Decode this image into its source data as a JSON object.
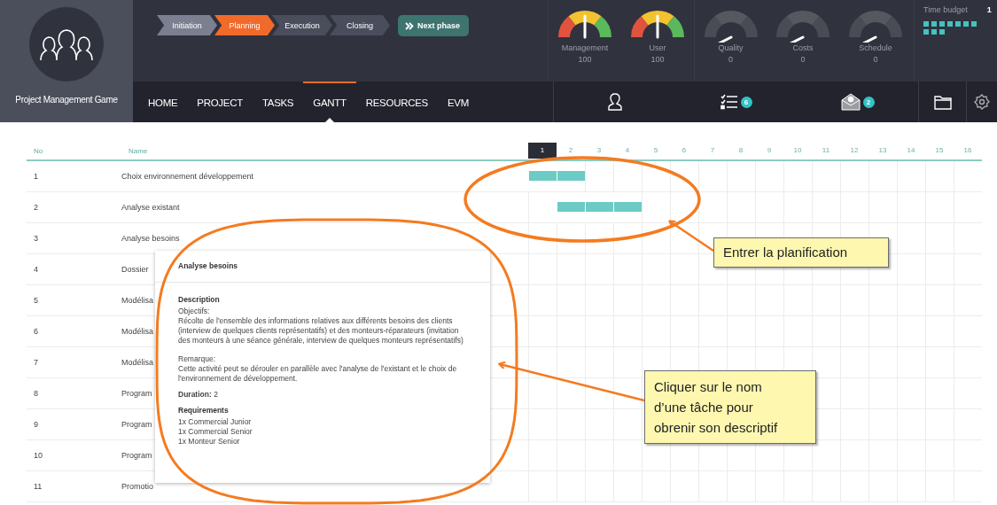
{
  "app": {
    "title": "Project Management Game"
  },
  "phases": [
    {
      "label": "Initiation",
      "completed": true,
      "selected": false
    },
    {
      "label": "Planning",
      "completed": false,
      "selected": true
    },
    {
      "label": "Execution",
      "completed": false,
      "selected": false
    },
    {
      "label": "Closing",
      "completed": false,
      "selected": false
    }
  ],
  "next_phase_button": {
    "label": "Next phase"
  },
  "gauges": [
    {
      "label": "Management",
      "value": "100",
      "kind": "colored"
    },
    {
      "label": "User",
      "value": "100",
      "kind": "colored"
    },
    {
      "label": "Quality",
      "value": "0",
      "kind": "plain"
    },
    {
      "label": "Costs",
      "value": "0",
      "kind": "plain"
    },
    {
      "label": "Schedule",
      "value": "0",
      "kind": "plain"
    }
  ],
  "time_budget": {
    "label": "Time budget",
    "value": "1",
    "blocks": [
      true,
      true,
      true,
      true,
      true,
      true,
      true,
      true,
      true,
      true
    ]
  },
  "nav_tabs": [
    {
      "label": "HOME",
      "selected": false
    },
    {
      "label": "PROJECT",
      "selected": false
    },
    {
      "label": "TASKS",
      "selected": false
    },
    {
      "label": "GANTT",
      "selected": true
    },
    {
      "label": "RESOURCES",
      "selected": false
    },
    {
      "label": "EVM",
      "selected": false
    }
  ],
  "toolbar": [
    {
      "kind": "person"
    },
    {
      "kind": "checklist",
      "badge": "6"
    },
    {
      "kind": "mail",
      "badge": "2"
    },
    {
      "kind": "folder"
    },
    {
      "kind": "settings"
    }
  ],
  "gantt": {
    "columns": {
      "no": "No",
      "name": "Name"
    },
    "weeks": [
      {
        "label": "1",
        "current": true
      },
      {
        "label": "2",
        "current": false
      },
      {
        "label": "3",
        "current": false
      },
      {
        "label": "4",
        "current": false
      },
      {
        "label": "5",
        "current": false
      },
      {
        "label": "6",
        "current": false
      },
      {
        "label": "7",
        "current": false
      },
      {
        "label": "8",
        "current": false
      },
      {
        "label": "9",
        "current": false
      },
      {
        "label": "10",
        "current": false
      },
      {
        "label": "11",
        "current": false
      },
      {
        "label": "12",
        "current": false
      },
      {
        "label": "13",
        "current": false
      },
      {
        "label": "14",
        "current": false
      },
      {
        "label": "15",
        "current": false
      },
      {
        "label": "16",
        "current": false
      }
    ],
    "rows": [
      {
        "no": "1",
        "name": "Choix environnement développement",
        "week_filled": [
          true,
          true,
          false,
          false,
          false,
          false,
          false,
          false,
          false,
          false,
          false,
          false,
          false,
          false,
          false,
          false
        ]
      },
      {
        "no": "2",
        "name": "Analyse existant",
        "week_filled": [
          false,
          true,
          true,
          true,
          false,
          false,
          false,
          false,
          false,
          false,
          false,
          false,
          false,
          false,
          false,
          false
        ]
      },
      {
        "no": "3",
        "name": "Analyse besoins"
      },
      {
        "no": "4",
        "name": "Dossier"
      },
      {
        "no": "5",
        "name": "Modélisa"
      },
      {
        "no": "6",
        "name": "Modélisa"
      },
      {
        "no": "7",
        "name": "Modélisa"
      },
      {
        "no": "8",
        "name": "Program"
      },
      {
        "no": "9",
        "name": "Program"
      },
      {
        "no": "10",
        "name": "Program"
      },
      {
        "no": "11",
        "name": "Promotio"
      }
    ]
  },
  "task_popup": {
    "title": "Analyse besoins",
    "section": "Description",
    "objectives_label": "Objectifs:",
    "objectives": "Récolte de l'ensemble des informations relatives aux différents besoins des clients (interview de quelques clients représentatifs) et des monteurs-réparateurs (invitation des monteurs à une séance générale, interview de quelques monteurs représentatifs)",
    "remark_label": "Remarque:",
    "remark": "Cette activité peut se dérouler en parallèle avec l'analyse de l'existant et le choix de l'environnement de développement.",
    "duration": "**Duration:** 2",
    "requirements_label": "Requirements",
    "requirements": [
      "1x Commercial Junior",
      "1x Commercial Senior",
      "1x Monteur Senior"
    ]
  },
  "annotations": [
    {
      "text": "Entrer la planification"
    },
    {
      "text": "Cliquer sur le nom d’une tâche pour obrenir son descriptif"
    }
  ]
}
